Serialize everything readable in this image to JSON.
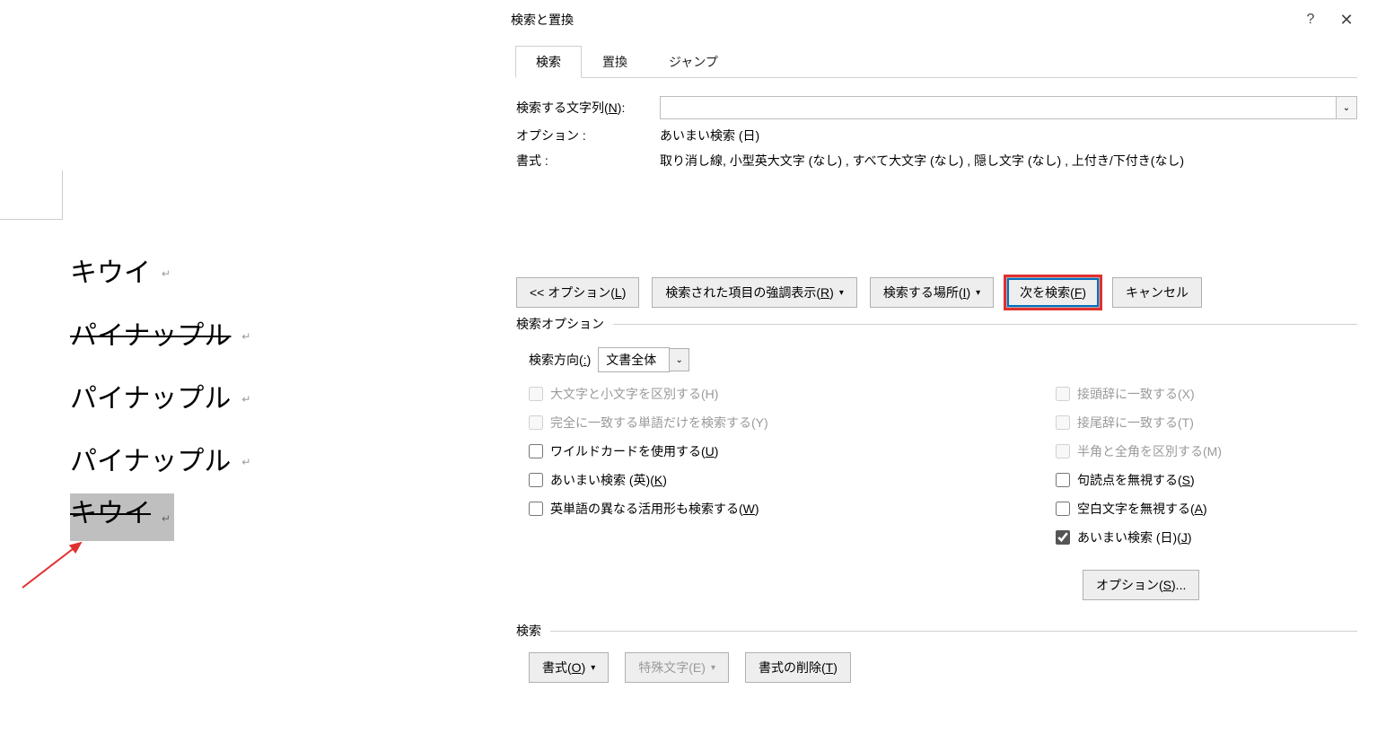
{
  "dialog": {
    "title": "検索と置換",
    "tabs": [
      "検索",
      "置換",
      "ジャンプ"
    ],
    "active_tab": 0,
    "search_label": "検索する文字列(N):",
    "search_label_key": "N",
    "search_value": "",
    "option_label": "オプション :",
    "option_value": "あいまい検索 (日)",
    "format_label": "書式 :",
    "format_value": "取り消し線, 小型英大文字 (なし) , すべて大文字 (なし) , 隠し文字 (なし) , 上付き/下付き(なし)",
    "buttons": {
      "less": "<< オプション(L)",
      "highlight": "検索された項目の強調表示(R)",
      "searchin": "検索する場所(I)",
      "findnext": "次を検索(F)",
      "cancel": "キャンセル"
    },
    "search_options": {
      "title": "検索オプション",
      "direction_label": "検索方向(:)",
      "direction_value": "文書全体",
      "left": [
        {
          "label": "大文字と小文字を区別する(H)",
          "checked": false,
          "disabled": true
        },
        {
          "label": "完全に一致する単語だけを検索する(Y)",
          "checked": false,
          "disabled": true
        },
        {
          "label": "ワイルドカードを使用する(U)",
          "checked": false,
          "disabled": false
        },
        {
          "label": "あいまい検索 (英)(K)",
          "checked": false,
          "disabled": false
        },
        {
          "label": "英単語の異なる活用形も検索する(W)",
          "checked": false,
          "disabled": false
        }
      ],
      "right": [
        {
          "label": "接頭辞に一致する(X)",
          "checked": false,
          "disabled": true
        },
        {
          "label": "接尾辞に一致する(T)",
          "checked": false,
          "disabled": true
        },
        {
          "label": "半角と全角を区別する(M)",
          "checked": false,
          "disabled": true
        },
        {
          "label": "句読点を無視する(S)",
          "checked": false,
          "disabled": false
        },
        {
          "label": "空白文字を無視する(A)",
          "checked": false,
          "disabled": false
        },
        {
          "label": "あいまい検索 (日)(J)",
          "checked": true,
          "disabled": false
        }
      ],
      "options_btn": "オプション(S)..."
    },
    "format_section": {
      "title": "検索",
      "format_btn": "書式(O)",
      "special_btn": "特殊文字(E)",
      "noformat_btn": "書式の削除(T)"
    }
  },
  "document": {
    "lines": [
      {
        "text": "キウイ",
        "strike": false,
        "highlight": false
      },
      {
        "text": "パイナップル",
        "strike": true,
        "highlight": false
      },
      {
        "text": "パイナップル",
        "strike": false,
        "highlight": false
      },
      {
        "text": "パイナップル",
        "strike": false,
        "highlight": false
      },
      {
        "text": "キウイ",
        "strike": true,
        "highlight": true
      }
    ]
  }
}
